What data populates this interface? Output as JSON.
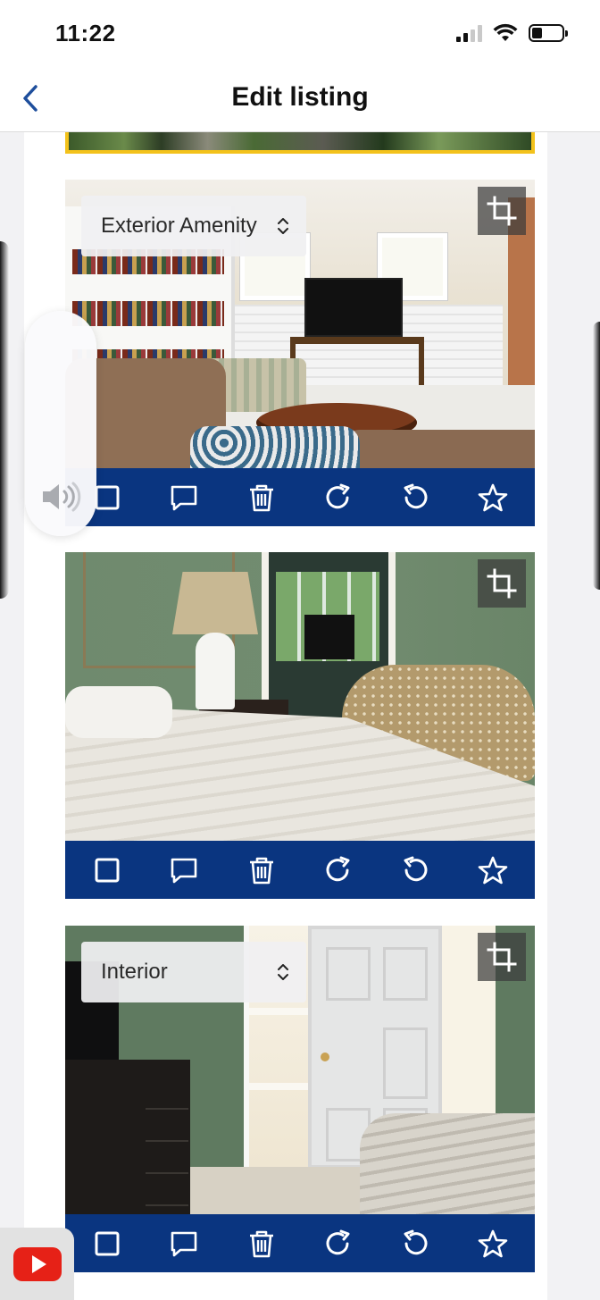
{
  "status_bar": {
    "time": "11:22",
    "signal_icon": "cellular-signal-icon",
    "wifi_icon": "wifi-icon",
    "battery_icon": "battery-icon",
    "battery_level": 0.3
  },
  "nav": {
    "title": "Edit listing",
    "back_icon": "chevron-left-icon"
  },
  "colors": {
    "toolbar": "#0a3580",
    "accent_back": "#1e4e9c",
    "highlight_border": "#f3c21b"
  },
  "photos": [
    {
      "category": "Exterior Amenity",
      "has_category_select": true,
      "scene": "living-room"
    },
    {
      "category": "",
      "has_category_select": false,
      "scene": "bedroom"
    },
    {
      "category": "Interior",
      "has_category_select": true,
      "scene": "bedroom-closet"
    }
  ],
  "toolbar_actions": [
    {
      "icon": "checkbox-icon",
      "action": "select"
    },
    {
      "icon": "comment-icon",
      "action": "caption"
    },
    {
      "icon": "trash-icon",
      "action": "delete"
    },
    {
      "icon": "rotate-clockwise-icon",
      "action": "rotate-right"
    },
    {
      "icon": "rotate-counterclockwise-icon",
      "action": "rotate-left"
    },
    {
      "icon": "star-icon",
      "action": "set-cover"
    }
  ],
  "overlays": {
    "volume_icon": "speaker-volume-icon",
    "pip_app_icon": "youtube-icon"
  }
}
